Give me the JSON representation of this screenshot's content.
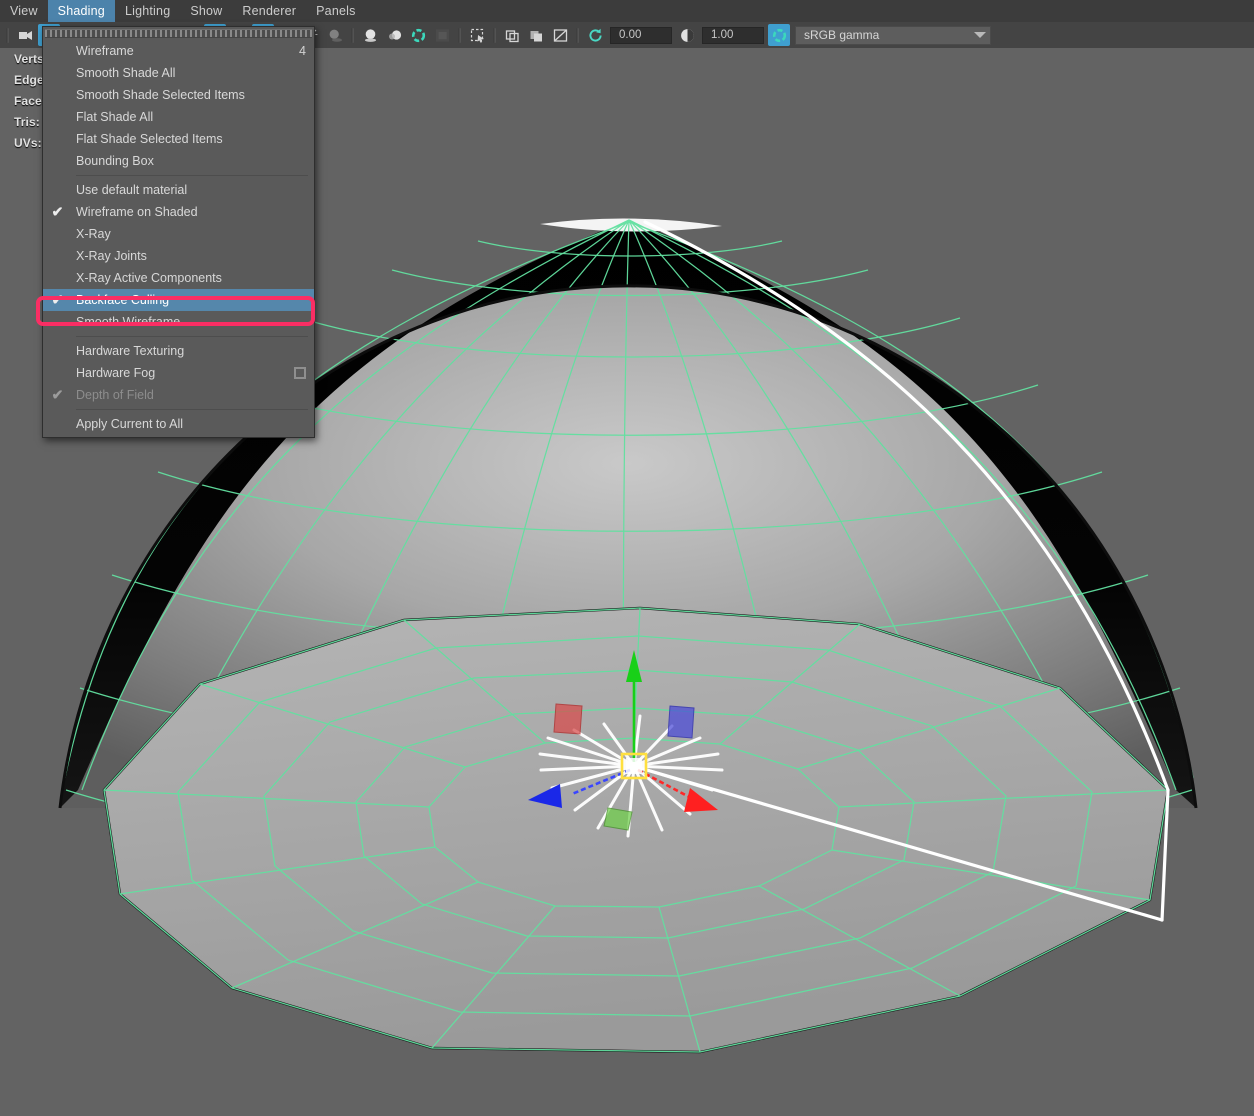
{
  "app": {
    "name": "Autodesk Maya viewport panel",
    "background_color": "#636363"
  },
  "menubar": {
    "items": [
      {
        "label": "View",
        "active": false
      },
      {
        "label": "Shading",
        "active": true
      },
      {
        "label": "Lighting",
        "active": false
      },
      {
        "label": "Show",
        "active": false
      },
      {
        "label": "Renderer",
        "active": false
      },
      {
        "label": "Panels",
        "active": false
      }
    ],
    "active_color": "#4c83ab"
  },
  "toolbar": {
    "icons": [
      {
        "name": "camera-icon",
        "glyph": "camera",
        "state": "normal"
      },
      {
        "name": "lock-camera-icon",
        "glyph": "lock",
        "state": "active"
      },
      {
        "name": "grid-icon",
        "glyph": "grid",
        "state": "normal"
      },
      {
        "name": "film-gate-icon",
        "glyph": "gate",
        "state": "normal"
      },
      {
        "name": "resolution-gate-icon",
        "glyph": "resgate",
        "state": "normal"
      },
      {
        "name": "gate-mask-icon",
        "glyph": "mask",
        "state": "normal"
      },
      {
        "name": "wireframe-shading-icon",
        "glyph": "wire-ball",
        "state": "normal"
      },
      {
        "name": "smooth-shade-all-icon",
        "glyph": "cube",
        "state": "active"
      },
      {
        "name": "shade-selected-icon",
        "glyph": "half-ball",
        "state": "normal"
      },
      {
        "name": "wireframe-on-shaded-icon",
        "glyph": "wire-globe",
        "state": "active"
      },
      {
        "name": "textured-icon",
        "glyph": "dots-ball",
        "state": "normal"
      },
      {
        "name": "use-lights-icon",
        "glyph": "bulb",
        "state": "normal"
      },
      {
        "name": "shadows-icon",
        "glyph": "shadow",
        "state": "dim"
      },
      {
        "name": "screen-space-ao-icon",
        "glyph": "ao-ball",
        "state": "normal"
      },
      {
        "name": "motion-blur-icon",
        "glyph": "blur-ball",
        "state": "normal"
      },
      {
        "name": "multisample-aa-icon",
        "glyph": "aa-ring",
        "state": "normal"
      },
      {
        "name": "depth-of-field-icon",
        "glyph": "dof-square",
        "state": "dim"
      },
      {
        "name": "isolate-select-icon",
        "glyph": "isolate",
        "state": "normal"
      },
      {
        "name": "xray-icon",
        "glyph": "xray",
        "state": "normal"
      },
      {
        "name": "xray-joints-icon",
        "glyph": "xray-joint",
        "state": "normal"
      },
      {
        "name": "xray-active-components-icon",
        "glyph": "xray-comp",
        "state": "normal"
      },
      {
        "name": "exposure-reset-icon",
        "glyph": "refresh",
        "state": "normal"
      }
    ],
    "exposure_value": "0.00",
    "gamma_value": "1.00",
    "colorspace": {
      "icon": "color-management-icon",
      "value": "sRGB gamma",
      "arrow": "chevron-down-icon"
    }
  },
  "hud": {
    "rows": [
      {
        "label": "Verts:"
      },
      {
        "label": "Edges:"
      },
      {
        "label": "Faces:"
      },
      {
        "label": "Tris:"
      },
      {
        "label": "UVs:"
      }
    ]
  },
  "shading_menu": {
    "tearoff": true,
    "groups": [
      {
        "type": "radio",
        "items": [
          {
            "label": "Wireframe",
            "selected": false,
            "accel": "4"
          },
          {
            "label": "Smooth Shade All",
            "selected": true,
            "accel": ""
          },
          {
            "label": "Smooth Shade Selected Items",
            "selected": false,
            "accel": ""
          },
          {
            "label": "Flat Shade All",
            "selected": false,
            "accel": ""
          },
          {
            "label": "Flat Shade Selected Items",
            "selected": false,
            "accel": ""
          },
          {
            "label": "Bounding Box",
            "selected": false,
            "accel": ""
          }
        ]
      },
      {
        "type": "check",
        "items": [
          {
            "label": "Use default material",
            "checked": false,
            "highlighted": false,
            "disabled": false,
            "optionbox": false
          },
          {
            "label": "Wireframe on Shaded",
            "checked": true,
            "highlighted": false,
            "disabled": false,
            "optionbox": false
          },
          {
            "label": "X-Ray",
            "checked": false,
            "highlighted": false,
            "disabled": false,
            "optionbox": false
          },
          {
            "label": "X-Ray Joints",
            "checked": false,
            "highlighted": false,
            "disabled": false,
            "optionbox": false
          },
          {
            "label": "X-Ray Active Components",
            "checked": false,
            "highlighted": false,
            "disabled": false,
            "optionbox": false
          },
          {
            "label": "Backface Culling",
            "checked": true,
            "highlighted": true,
            "disabled": false,
            "optionbox": false
          },
          {
            "label": "Smooth Wireframe",
            "checked": false,
            "highlighted": false,
            "disabled": false,
            "optionbox": false
          }
        ]
      },
      {
        "type": "check",
        "items": [
          {
            "label": "Hardware Texturing",
            "checked": false,
            "highlighted": false,
            "disabled": false,
            "optionbox": false
          },
          {
            "label": "Hardware Fog",
            "checked": false,
            "highlighted": false,
            "disabled": false,
            "optionbox": true
          },
          {
            "label": "Depth of Field",
            "checked": true,
            "highlighted": false,
            "disabled": true,
            "optionbox": false
          }
        ]
      },
      {
        "type": "command",
        "items": [
          {
            "label": "Apply Current to All"
          }
        ]
      }
    ],
    "highlight_color": "#5587ab",
    "background_color": "#5a5a5a"
  },
  "annotation": {
    "shape": "rounded-rectangle",
    "color": "#fa2e64",
    "target_label": "Backface Culling"
  },
  "viewport": {
    "object": "polygon hemisphere (dome) with disc cap",
    "wireframe_color": "#62e0a0",
    "selected_edge_color": "#ffffff",
    "shaded_color": "#a9a9a9",
    "backface_color": "#000000",
    "manipulator": {
      "name": "move-manipulator",
      "axis_x_color": "#ff2020",
      "axis_y_color": "#18d018",
      "axis_z_color": "#2020ff",
      "center_color": "#ffe040"
    }
  }
}
